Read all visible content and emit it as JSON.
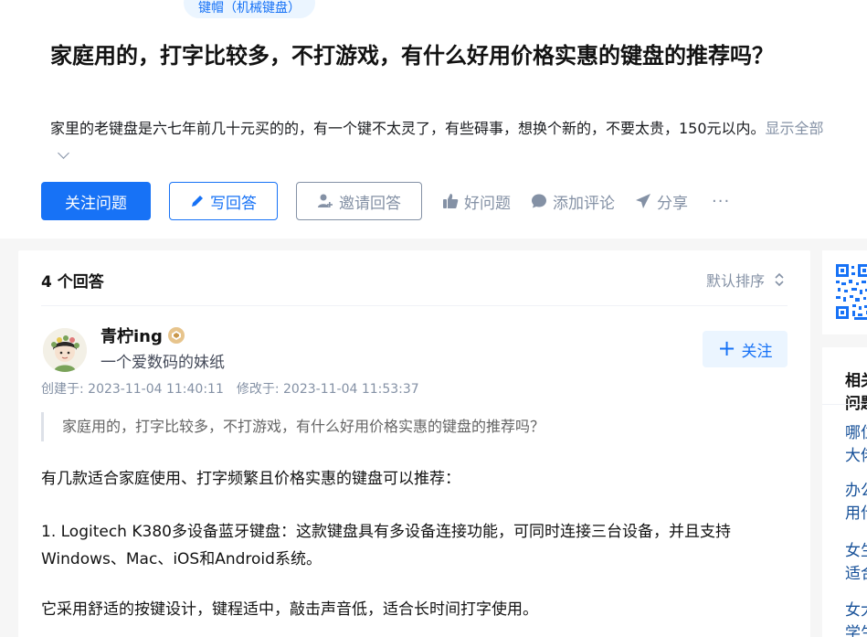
{
  "question": {
    "topic_tag": "键帽（机械键盘）",
    "title": "家庭用的，打字比较多，不打游戏，有什么好用价格实惠的键盘的推荐吗？",
    "detail": "家里的老键盘是六七年前几十元买的的，有一个键不太灵了，有些碍事，想换个新的，不要太贵，150元以内。",
    "show_all": "显示全部",
    "actions": {
      "follow": "关注问题",
      "write_answer": "写回答",
      "invite": "邀请回答",
      "good_question": "好问题",
      "add_comment": "添加评论",
      "share": "分享",
      "more": "···"
    }
  },
  "answers": {
    "count_label": "4 个回答",
    "sort_label": "默认排序",
    "first": {
      "author_name": "青柠ing",
      "author_bio": "一个爱数码的妹纸",
      "follow_label": "关注",
      "created": "创建于: 2023-11-04 11:40:11",
      "modified": "修改于: 2023-11-04 11:53:37",
      "quote": "家庭用的，打字比较多，不打游戏，有什么好用价格实惠的键盘的推荐吗？",
      "paragraphs": [
        "有几款适合家庭使用、打字频繁且价格实惠的键盘可以推荐：",
        "1. Logitech K380多设备蓝牙键盘：这款键盘具有多设备连接功能，可同时连接三台设备，并且支持Windows、Mac、iOS和Android系统。",
        "它采用舒适的按键设计，键程适中，敲击声音低，适合长时间打字使用。"
      ]
    }
  },
  "sidebar": {
    "related_title": "相关问题",
    "related": [
      "哪位大佬能推荐一款两百的机械键盘？",
      "办公用什么键盘比较好用？",
      "女生适合用什么样的机械键盘？",
      "女大学生选什么键盘？"
    ]
  },
  "colors": {
    "primary": "#1772f6",
    "muted": "#8491a5",
    "link": "#175199"
  }
}
